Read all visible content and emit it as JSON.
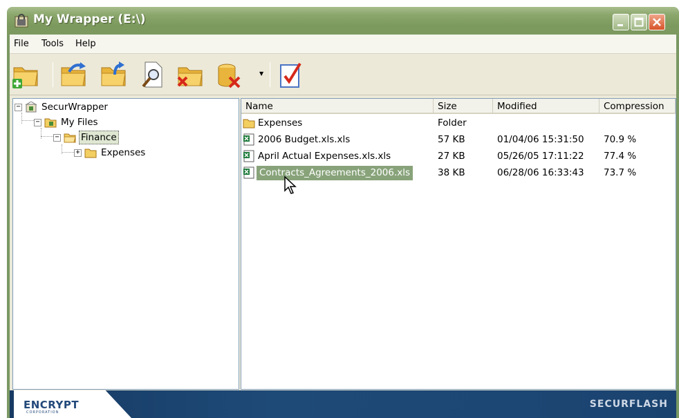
{
  "window": {
    "title": "My Wrapper (E:\\)",
    "icons": {
      "app": "wrapper-lock-icon",
      "minimize": "minimize-icon",
      "maximize": "maximize-icon",
      "close": "close-icon"
    }
  },
  "menu": [
    "File",
    "Tools",
    "Help"
  ],
  "toolbar": {
    "buttons": [
      {
        "name": "new-folder-add-icon"
      },
      {
        "name": "open-folder-icon"
      },
      {
        "name": "extract-folder-icon"
      },
      {
        "name": "search-file-icon"
      },
      {
        "name": "delete-folder-icon"
      },
      {
        "name": "delete-database-icon"
      },
      {
        "name": "checklist-icon"
      }
    ]
  },
  "tree": {
    "items": [
      {
        "label": "SecurWrapper",
        "expander": "−",
        "icon": "secure-home-icon"
      },
      {
        "label": "My Files",
        "expander": "−",
        "icon": "secure-folder-icon"
      },
      {
        "label": "Finance",
        "expander": "−",
        "icon": "open-folder-icon"
      },
      {
        "label": "Expenses",
        "expander": "+",
        "icon": "folder-icon"
      }
    ],
    "selected": "Finance"
  },
  "list": {
    "columns": [
      "Name",
      "Size",
      "Modified",
      "Compression"
    ],
    "rows": [
      {
        "name": "Expenses",
        "size": "Folder",
        "modified": "",
        "compression": "",
        "icon": "folder-icon"
      },
      {
        "name": "2006 Budget.xls.xls",
        "size": "57 KB",
        "modified": "01/04/06 15:31:50",
        "compression": "70.9 %",
        "icon": "excel-file-icon"
      },
      {
        "name": "April Actual Expenses.xls.xls",
        "size": "27 KB",
        "modified": "05/26/05 17:11:22",
        "compression": "77.4 %",
        "icon": "excel-file-icon"
      },
      {
        "name": "Contracts_Agreements_2006.xls",
        "size": "38 KB",
        "modified": "06/28/06 16:33:43",
        "compression": "73.7 %",
        "icon": "excel-file-icon",
        "selected": true
      }
    ]
  },
  "status": {
    "logo": "ENCRYPT",
    "logo_sub": "CORPORATION",
    "brand": "SECURFLASH"
  },
  "colors": {
    "titlebar": "#7c995d",
    "selection": "#88a37a",
    "statusbar": "#1e4a78"
  }
}
